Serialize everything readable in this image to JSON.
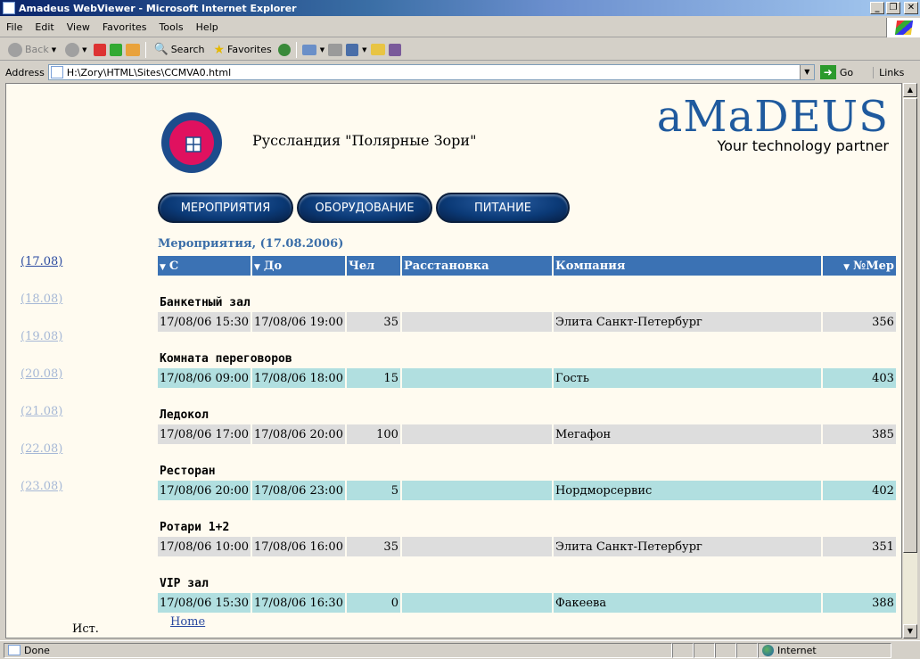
{
  "window": {
    "title": "Amadeus WebViewer - Microsoft Internet Explorer"
  },
  "menu": [
    "File",
    "Edit",
    "View",
    "Favorites",
    "Tools",
    "Help"
  ],
  "toolbar": {
    "back": "Back",
    "search": "Search",
    "favorites": "Favorites"
  },
  "address": {
    "label": "Address",
    "value": "H:\\Zory\\HTML\\Sites\\CCMVA0.html",
    "go": "Go",
    "links": "Links"
  },
  "page": {
    "hotel_name": "Руссландия \"Полярные Зори\"",
    "brand": {
      "word": "aMaDEUS",
      "tagline": "Your technology partner"
    },
    "nav_buttons": [
      "МЕРОПРИЯТИЯ",
      "ОБОРУДОВАНИЕ",
      "ПИТАНИЕ"
    ],
    "section_title": "Мероприятия, (17.08.2006)",
    "dates": [
      "(17.08)",
      "(18.08)",
      "(19.08)",
      "(20.08)",
      "(21.08)",
      "(22.08)",
      "(23.08)"
    ],
    "columns": [
      "С",
      "До",
      "Чел",
      "Расстановка",
      "Компания",
      "№Мер"
    ],
    "rooms": [
      {
        "name": "Банкетный зал",
        "from": "17/08/06 15:30",
        "to": "17/08/06 19:00",
        "people": "35",
        "layout": "",
        "company": "Элита Санкт-Петербург",
        "num": "356"
      },
      {
        "name": "Комната переговоров",
        "from": "17/08/06 09:00",
        "to": "17/08/06 18:00",
        "people": "15",
        "layout": "",
        "company": "Гость",
        "num": "403"
      },
      {
        "name": "Ледокол",
        "from": "17/08/06 17:00",
        "to": "17/08/06 20:00",
        "people": "100",
        "layout": "",
        "company": "Мегафон",
        "num": "385"
      },
      {
        "name": "Ресторан",
        "from": "17/08/06 20:00",
        "to": "17/08/06 23:00",
        "people": "5",
        "layout": "",
        "company": "Нордморсервис",
        "num": "402"
      },
      {
        "name": "Ротари 1+2",
        "from": "17/08/06 10:00",
        "to": "17/08/06 16:00",
        "people": "35",
        "layout": "",
        "company": "Элита Санкт-Петербург",
        "num": "351"
      },
      {
        "name": "VIP зал",
        "from": "17/08/06 15:30",
        "to": "17/08/06 16:30",
        "people": "0",
        "layout": "",
        "company": "Факеева",
        "num": "388"
      }
    ],
    "home": "Home",
    "ist": "Ист."
  },
  "status": {
    "text": "Done",
    "zone": "Internet"
  },
  "colors": {
    "header_blue": "#3b72b4",
    "row_gray": "#dddddd",
    "row_cyan": "#b1dfe0",
    "brand_blue": "#1f5a9e"
  }
}
